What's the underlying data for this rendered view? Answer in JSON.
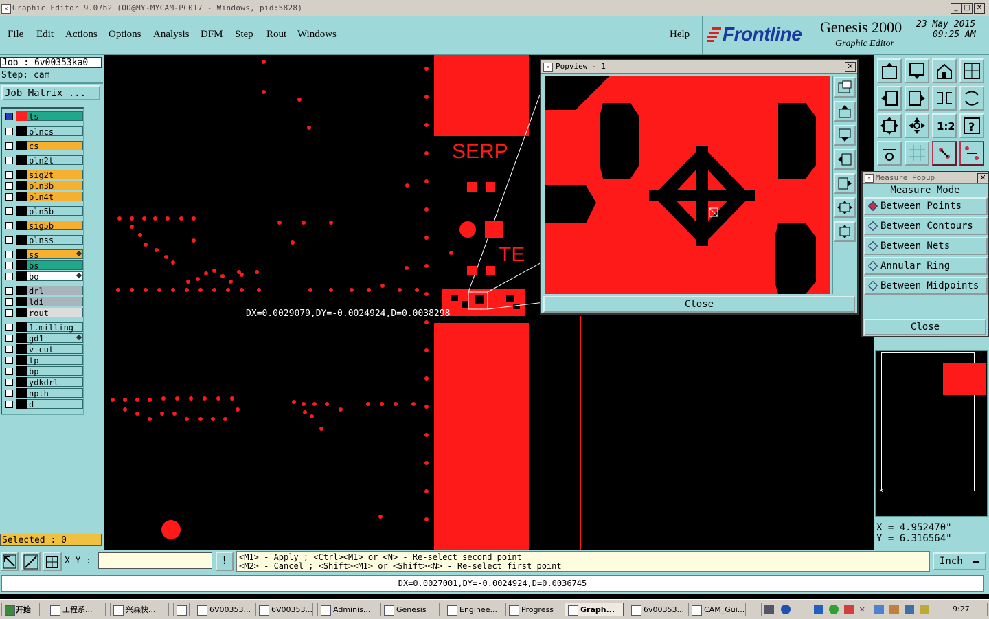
{
  "window": {
    "title": "Graphic Editor 9.07b2 (OO@MY-MYCAM-PC017 - Windows, pid:5828)",
    "min_btn": "_",
    "max_btn": "□",
    "close_btn": "✕"
  },
  "menu": {
    "items": [
      "File",
      "Edit",
      "Actions",
      "Options",
      "Analysis",
      "DFM",
      "Step",
      "Rout",
      "Windows"
    ],
    "help": "Help"
  },
  "brand": {
    "logo": "Frontline",
    "product": "Genesis 2000",
    "subtitle": "Graphic Editor",
    "date": "23 May 2015",
    "time": "09:25 AM"
  },
  "job": {
    "job_label": "Job : 6v00353ka0",
    "step_label": "Step: cam",
    "matrix_button": "Job Matrix ..."
  },
  "layers": [
    {
      "name": "ts",
      "color": "#1fa88a",
      "swatch": "#ff2020",
      "active": true
    },
    {
      "name": "plncs",
      "color": "#9ed8d8"
    },
    {
      "name": "cs",
      "color": "#f5b030"
    },
    {
      "name": "pln2t",
      "color": "#9ed8d8"
    },
    {
      "name": "sig2t",
      "color": "#f5b030"
    },
    {
      "name": "pln3b",
      "color": "#f5b030"
    },
    {
      "name": "pln4t",
      "color": "#f5b030"
    },
    {
      "name": "pln5b",
      "color": "#9ed8d8"
    },
    {
      "name": "sig5b",
      "color": "#f5b030"
    },
    {
      "name": "plnss",
      "color": "#9ed8d8"
    },
    {
      "name": "ss",
      "color": "#f5b030",
      "mark": true
    },
    {
      "name": "bs",
      "color": "#1fa88a"
    },
    {
      "name": "bo",
      "color": "#ffffff",
      "mark": true
    },
    {
      "name": "drl",
      "color": "#a9b4bc"
    },
    {
      "name": "ldi",
      "color": "#a9b4bc"
    },
    {
      "name": "rout",
      "color": "#dcdcdc"
    },
    {
      "name": "1.milling",
      "color": "#9ed8d8"
    },
    {
      "name": "gd1",
      "color": "#9ed8d8",
      "mark": true
    },
    {
      "name": "v-cut",
      "color": "#9ed8d8"
    },
    {
      "name": "tp",
      "color": "#9ed8d8"
    },
    {
      "name": "bp",
      "color": "#9ed8d8"
    },
    {
      "name": "ydkdrl",
      "color": "#9ed8d8"
    },
    {
      "name": "npth",
      "color": "#9ed8d8"
    },
    {
      "name": "d",
      "color": "#9ed8d8"
    }
  ],
  "selected": "Selected : 0",
  "canvas": {
    "measure_text": "DX=0.0029079,DY=-0.0024924,D=0.0038298",
    "label_serp": "SERP",
    "label_te": "TE",
    "pad_color": "#ff1a1a"
  },
  "popview": {
    "title": "Popview - 1",
    "close": "Close"
  },
  "measure": {
    "title": "Measure Popup",
    "mode_label": "Measure Mode",
    "options": [
      "Between Points",
      "Between Contours",
      "Between Nets",
      "Annular Ring",
      "Between Midpoints"
    ],
    "selected_index": 0,
    "close": "Close"
  },
  "coords": {
    "x": "X = 4.952470\"",
    "y": "Y = 6.316564\""
  },
  "bottom": {
    "xy_label": "X Y :",
    "xy_value": "",
    "hint1": "<M1> - Apply  ; <Ctrl><M1> or <N> - Re-select second point",
    "hint2": "<M2> - Cancel ; <Shift><M1> or <Shift><N> - Re-select first point",
    "units": "Inch",
    "status": "DX=0.0027001,DY=-0.0024924,D=0.0036745"
  },
  "taskbar": {
    "start": "开始",
    "tasks": [
      "工程系...",
      "兴森快...",
      "",
      "6V00353...",
      "6V00353...",
      "Adminis...",
      "Genesis",
      "Enginee...",
      "Progress",
      "Graph...",
      "6v00353...",
      "CAM_Gui..."
    ],
    "clock": "9:27"
  }
}
